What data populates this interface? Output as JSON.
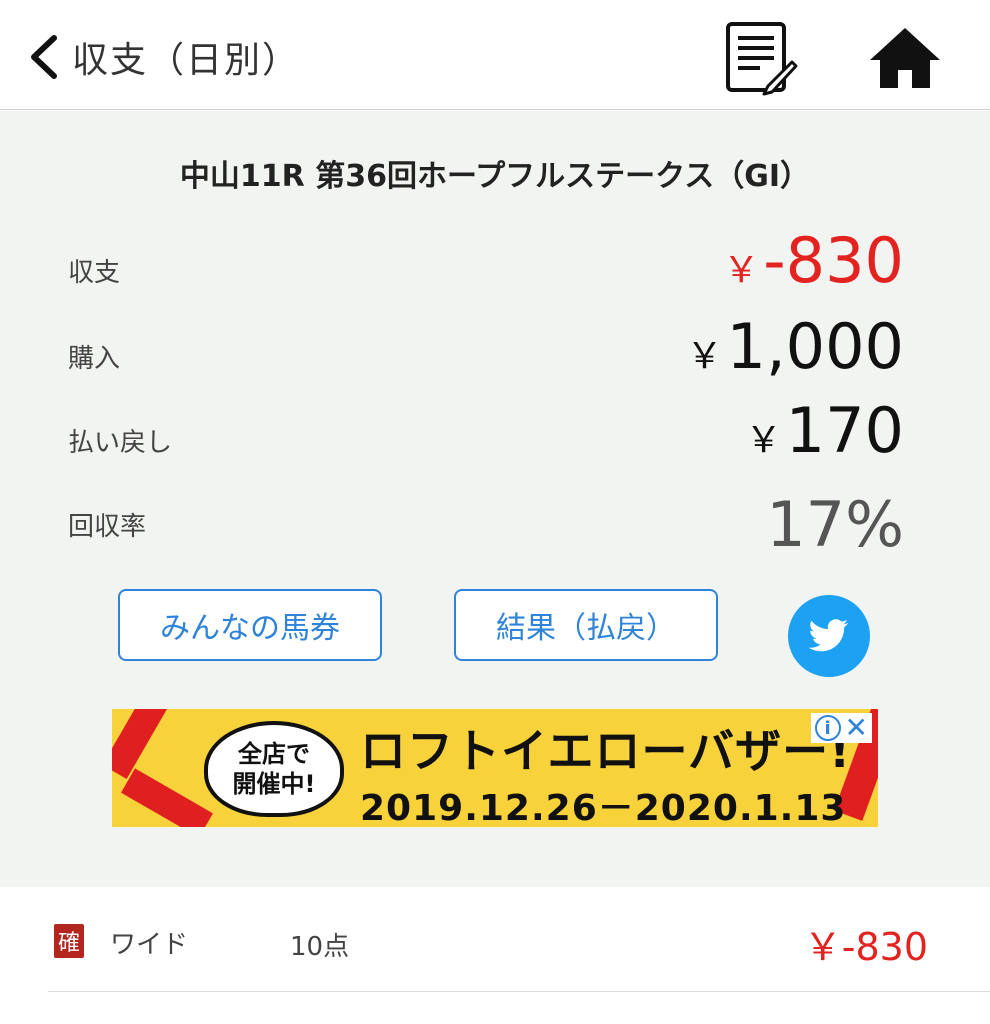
{
  "header": {
    "title": "収支（日別）"
  },
  "race": {
    "title": "中山11R  第36回ホープフルステークス（GI）"
  },
  "summary": {
    "balance_label": "収支",
    "balance_currency": "￥",
    "balance_value": "-830",
    "purchase_label": "購入",
    "purchase_currency": "￥",
    "purchase_value": "1,000",
    "payout_label": "払い戻し",
    "payout_currency": "￥",
    "payout_value": "170",
    "rate_label": "回収率",
    "rate_value": "17%"
  },
  "actions": {
    "minna_label": "みんなの馬券",
    "result_label": "結果（払戻）"
  },
  "ad": {
    "bubble_line1": "全店で",
    "bubble_line2": "開催中!",
    "headline": "ロフトイエローバザー!",
    "dates": "2019.12.26－2020.1.13",
    "info_glyph": "i",
    "close_glyph": "✕"
  },
  "bets": [
    {
      "badge": "確",
      "type": "ワイド",
      "points": "10点",
      "amount": "￥-830"
    }
  ],
  "colors": {
    "negative": "#e3231f",
    "accent": "#2f84d9",
    "twitter": "#1da1f2",
    "summary_bg": "#f2f4f1"
  },
  "icons": {
    "back": "chevron-left-icon",
    "memo": "memo-edit-icon",
    "home": "home-icon",
    "twitter": "twitter-icon"
  }
}
